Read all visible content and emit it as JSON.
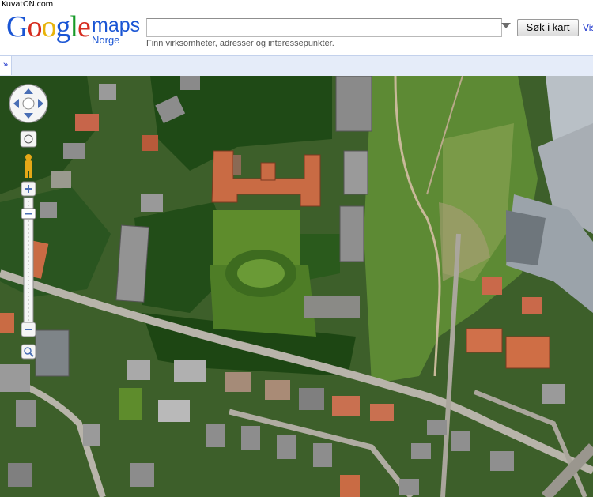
{
  "watermark": "KuvatON.com",
  "header": {
    "logo": "Google",
    "product": "maps",
    "region": "Norge",
    "search": {
      "value": "",
      "placeholder": ""
    },
    "search_button": "Søk i kart",
    "link": "Vis",
    "hint": "Finn virksomheter, adresser og interessepunkter."
  },
  "bar": {
    "toggle": "»"
  },
  "map": {
    "view": "satellite",
    "controls": [
      "pan-control",
      "reset-control",
      "street-view-pegman",
      "zoom-in",
      "zoom-slider",
      "zoom-out",
      "zoom-area"
    ]
  },
  "colors": {
    "brand_blue": "#1a55d4",
    "bar_bg": "#e5ecf9",
    "grass": "#4f7a2c",
    "trees": "#1f4a16"
  }
}
